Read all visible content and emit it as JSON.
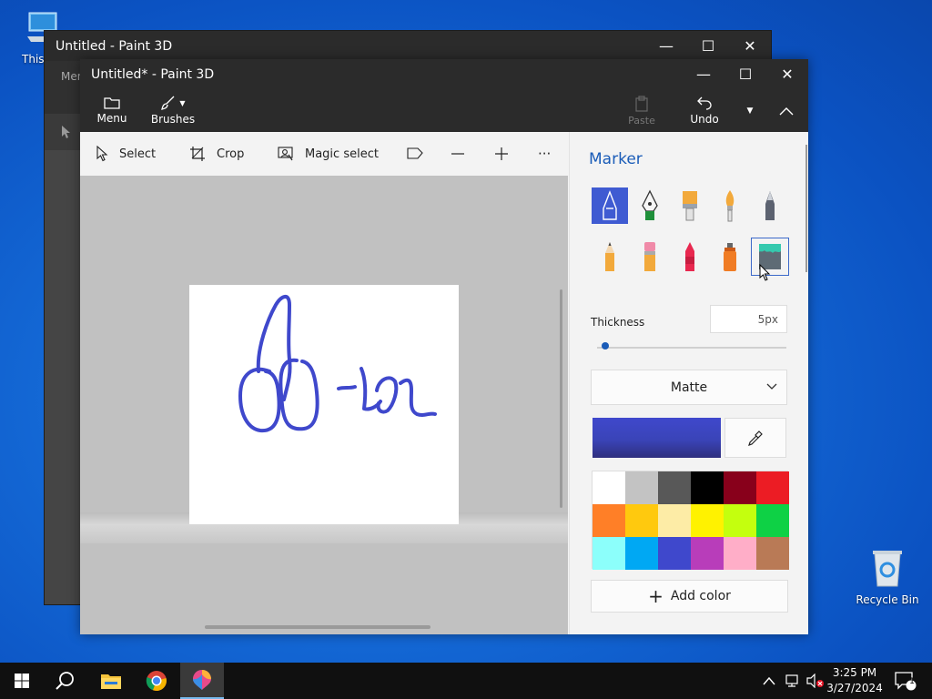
{
  "desktop": {
    "icons": [
      {
        "label": "This PC"
      },
      {
        "label": "Recycle Bin"
      }
    ]
  },
  "back_window": {
    "title": "Untitled - Paint 3D",
    "menu_label": "Menu"
  },
  "window": {
    "title": "Untitled* - Paint 3D",
    "ribbon": {
      "menu": "Menu",
      "brushes": "Brushes",
      "paste": "Paste",
      "undo": "Undo"
    },
    "toolbar": {
      "select": "Select",
      "crop": "Crop",
      "magic_select": "Magic select",
      "more": "···"
    }
  },
  "panel": {
    "title": "Marker",
    "brushes": [
      {
        "name": "marker",
        "icon": "marker-icon",
        "selected": true
      },
      {
        "name": "calligraphy pen",
        "icon": "calligraphy-pen-icon"
      },
      {
        "name": "oil brush",
        "icon": "oil-brush-icon"
      },
      {
        "name": "watercolor",
        "icon": "watercolor-brush-icon"
      },
      {
        "name": "pixel pen",
        "icon": "pixel-pen-icon"
      },
      {
        "name": "pencil",
        "icon": "pencil-icon"
      },
      {
        "name": "eraser",
        "icon": "eraser-icon"
      },
      {
        "name": "crayon",
        "icon": "crayon-icon"
      },
      {
        "name": "spray can",
        "icon": "spray-can-icon"
      },
      {
        "name": "fill",
        "icon": "fill-bucket-icon",
        "hover": true
      }
    ],
    "thickness_label": "Thickness",
    "thickness_value": "5px",
    "thickness_level": 0.02,
    "finish": "Matte",
    "current_color": "#3f48cc",
    "palette": [
      "#ffffff",
      "#c3c3c3",
      "#585858",
      "#000000",
      "#88001b",
      "#ec1c24",
      "#ff7f27",
      "#ffc90e",
      "#fdeca6",
      "#fff200",
      "#c4ff0e",
      "#0ed145",
      "#8cfffb",
      "#00a8f3",
      "#3f48cc",
      "#b83dba",
      "#ffaec8",
      "#b97a56"
    ],
    "add_color": "Add color"
  },
  "taskbar": {
    "time": "3:25 PM",
    "date": "3/27/2024",
    "notifications": "1"
  }
}
